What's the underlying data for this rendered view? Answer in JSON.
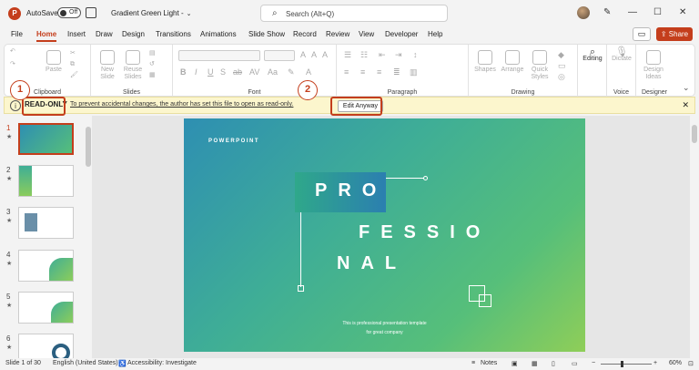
{
  "app": {
    "logo_letter": "P",
    "autosave_label": "AutoSave",
    "autosave_state": "Off",
    "file_name": "Gradient Green Light",
    "file_name_suffix": "-",
    "search_placeholder": "Search (Alt+Q)"
  },
  "menu_tabs": [
    "File",
    "Home",
    "Insert",
    "Draw",
    "Design",
    "Transitions",
    "Animations",
    "Slide Show",
    "Record",
    "Review",
    "View",
    "Developer",
    "Help"
  ],
  "active_tab": "Home",
  "share_label": "Share",
  "ribbon": {
    "groups": [
      "Clipboard",
      "Slides",
      "Font",
      "Paragraph",
      "Drawing",
      "Voice",
      "Designer"
    ],
    "clipboard_paste": "Paste",
    "slides_new": "New Slide",
    "slides_reuse": "Reuse Slides",
    "drawing_shapes": "Shapes",
    "drawing_arrange": "Arrange",
    "drawing_quick": "Quick Styles",
    "editing": "Editing",
    "dictate": "Dictate",
    "design_ideas": "Design Ideas"
  },
  "infobar": {
    "badge": "READ-ONLY",
    "message": "To prevent accidental changes, the author has set this file to open as read-only.",
    "edit_button": "Edit Anyway"
  },
  "callouts": [
    "1",
    "2"
  ],
  "thumbnails": [
    {
      "num": "1",
      "star": "★"
    },
    {
      "num": "2",
      "star": "★"
    },
    {
      "num": "3",
      "star": "★"
    },
    {
      "num": "4",
      "star": "★"
    },
    {
      "num": "5",
      "star": "★"
    },
    {
      "num": "6",
      "star": "★"
    }
  ],
  "slide": {
    "brand": "POWERPOINT",
    "line1": "PRO",
    "line2": "FESSIO",
    "line3": "NAL",
    "sub1": "This is professional presentation template",
    "sub2": "for great company"
  },
  "status": {
    "slide_info": "Slide 1 of 30",
    "language": "English (United States)",
    "accessibility": "Accessibility: Investigate",
    "notes": "Notes",
    "zoom": "60%"
  },
  "colors": {
    "accent": "#c43e1c",
    "infobar": "#fcf6cd"
  }
}
